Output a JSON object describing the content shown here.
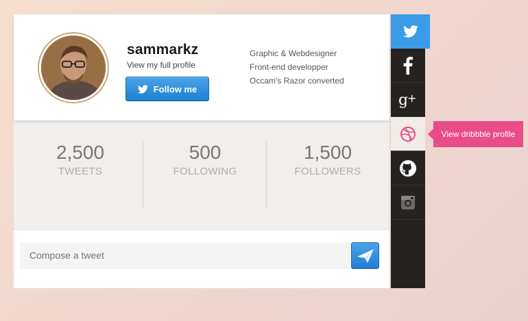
{
  "profile": {
    "username": "sammarkz",
    "profile_link": "View my full profile",
    "follow_label": "Follow me",
    "bio": [
      "Graphic & Webdesigner",
      "Front-end developper",
      "Occam's Razor converted"
    ]
  },
  "stats": [
    {
      "value": "2,500",
      "label": "TWEETS"
    },
    {
      "value": "500",
      "label": "FOLLOWING"
    },
    {
      "value": "1,500",
      "label": "FOLLOWERS"
    }
  ],
  "compose": {
    "placeholder": "Compose a tweet"
  },
  "social": {
    "items": [
      "twitter-icon",
      "facebook-icon",
      "google-plus-icon",
      "dribbble-icon",
      "github-icon",
      "instagram-icon"
    ],
    "tooltip": "View dribbble profile"
  },
  "colors": {
    "twitter_blue": "#3a9ce8",
    "dribbble_pink": "#ea4c89",
    "sidebar_dark": "#252220",
    "stats_bg": "#f1eeeb"
  }
}
